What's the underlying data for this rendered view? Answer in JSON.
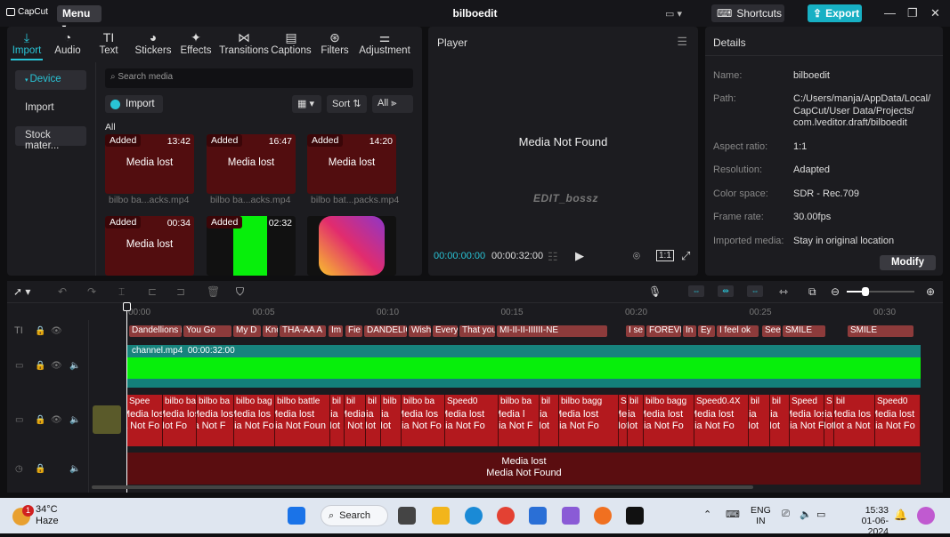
{
  "app": {
    "logo_text": "CapCut",
    "menu_label": "Menu",
    "project_title": "bilboedit",
    "shortcuts_label": "Shortcuts",
    "export_label": "Export"
  },
  "toolbar": {
    "tabs": [
      {
        "label": "Import",
        "icon": "import-icon"
      },
      {
        "label": "Audio",
        "icon": "audio-icon"
      },
      {
        "label": "Text",
        "icon": "text-icon"
      },
      {
        "label": "Stickers",
        "icon": "stickers-icon"
      },
      {
        "label": "Effects",
        "icon": "effects-icon"
      },
      {
        "label": "Transitions",
        "icon": "transitions-icon"
      },
      {
        "label": "Captions",
        "icon": "captions-icon"
      },
      {
        "label": "Filters",
        "icon": "filters-icon"
      },
      {
        "label": "Adjustment",
        "icon": "adjustment-icon"
      }
    ]
  },
  "side_nav": {
    "items": [
      "Device",
      "Import",
      "Stock mater..."
    ]
  },
  "media": {
    "search_placeholder": "Search media",
    "import_label": "Import",
    "sort_label": "Sort",
    "filter_label": "All",
    "section_label": "All",
    "items": [
      {
        "badge": "Added",
        "duration": "13:42",
        "status": "Media lost",
        "name": "bilbo ba...acks.mp4"
      },
      {
        "badge": "Added",
        "duration": "16:47",
        "status": "Media lost",
        "name": "bilbo ba...acks.mp4"
      },
      {
        "badge": "Added",
        "duration": "14:20",
        "status": "Media lost",
        "name": "bilbo bat...packs.mp4"
      },
      {
        "badge": "Added",
        "duration": "00:34",
        "status": "Media lost",
        "name": ""
      },
      {
        "badge": "Added",
        "duration": "02:32",
        "status": "",
        "name": ""
      },
      {
        "badge": "",
        "duration": "",
        "status": "",
        "name": ""
      }
    ]
  },
  "player": {
    "title": "Player",
    "message": "Media Not Found",
    "watermark": "EDIT_bossz",
    "current_time": "00:00:00:00",
    "total_time": "00:00:32:00"
  },
  "details": {
    "title": "Details",
    "fields": [
      {
        "label": "Name:",
        "value": "bilboedit"
      },
      {
        "label": "Path:",
        "value": "C:/Users/manja/AppData/Local/ CapCut/User Data/Projects/ com.lveditor.draft/bilboedit"
      },
      {
        "label": "Aspect ratio:",
        "value": "1:1"
      },
      {
        "label": "Resolution:",
        "value": "Adapted"
      },
      {
        "label": "Color space:",
        "value": "SDR - Rec.709"
      },
      {
        "label": "Frame rate:",
        "value": "30.00fps"
      },
      {
        "label": "Imported media:",
        "value": "Stay in original location"
      }
    ],
    "modify_label": "Modify"
  },
  "timeline": {
    "ruler": [
      "00:00",
      "00:05",
      "00:10",
      "00:15",
      "00:20",
      "00:25",
      "00:30"
    ],
    "text_clips": [
      "Dandellions i",
      "You Go",
      "My D",
      "Kno",
      "THA-AA A",
      "Im",
      "Fie",
      "DANDELIC",
      "Wish",
      "Every",
      "That you",
      "MI-II-II-IIIIII-NE",
      "I se",
      "FOREVE",
      "In",
      "Ey",
      "I feel ok",
      "See",
      "SMILE",
      "SMILE"
    ],
    "main_clip_name": "channel.mp4",
    "main_clip_duration": "00:00:32:00",
    "lost_clips": [
      {
        "title": "Spee",
        "l1": "Media los",
        "l2": "a Not Fo"
      },
      {
        "title": "bilbo ba",
        "l1": "Media los",
        "l2": "Not Fo"
      },
      {
        "title": "bilbo ba",
        "l1": "Media los",
        "l2": "ia Not F"
      },
      {
        "title": "bilbo bag",
        "l1": "Media los",
        "l2": "dia Not Fo"
      },
      {
        "title": "bilbo battle",
        "l1": "Media lost",
        "l2": "dia Not Foun"
      },
      {
        "title": "bil",
        "l1": "dia",
        "l2": "Not"
      },
      {
        "title": "bil",
        "l1": "Media",
        "l2": "a Not"
      },
      {
        "title": "bil",
        "l1": "dia",
        "l2": "Not"
      },
      {
        "title": "bilb",
        "l1": "dia",
        "l2": "Not"
      },
      {
        "title": "bilbo ba",
        "l1": "Media los",
        "l2": "dia Not Fo"
      },
      {
        "title": "Speed0",
        "l1": "Media lost",
        "l2": "dia Not Fo"
      },
      {
        "title": "bilbo ba",
        "l1": "Media l",
        "l2": "dia Not F"
      },
      {
        "title": "bil",
        "l1": "dia",
        "l2": "Not"
      },
      {
        "title": "bilbo bagg",
        "l1": "Media lost",
        "l2": "dia Not Fo"
      },
      {
        "title": "S",
        "l1": "Media",
        "l2": "Not"
      },
      {
        "title": "bil",
        "l1": "dia",
        "l2": "Not"
      },
      {
        "title": "bilbo bagg",
        "l1": "Media lost",
        "l2": "dia Not Fo"
      },
      {
        "title": "Speed0.4X",
        "l1": "Media lost",
        "l2": "dia Not Fo"
      },
      {
        "title": "bil",
        "l1": "dia",
        "l2": "Not"
      },
      {
        "title": "bil",
        "l1": "dia",
        "l2": "Not"
      },
      {
        "title": "Speed",
        "l1": "Media los",
        "l2": "dia Not Fo"
      },
      {
        "title": "S",
        "l1": "dia",
        "l2": "Not"
      },
      {
        "title": "bil",
        "l1": "Media los",
        "l2": "Not a Not"
      },
      {
        "title": "Speed0",
        "l1": "Media lost",
        "l2": "dia Not Fo"
      }
    ],
    "audio_clip_l1": "Media lost",
    "audio_clip_l2": "Media Not Found"
  },
  "taskbar": {
    "temperature": "34°C",
    "weather": "Haze",
    "notification_count": "1",
    "search_label": "Search",
    "lang_top": "ENG",
    "lang_bottom": "IN",
    "time": "15:33",
    "date": "01-06-2024"
  },
  "colors": {
    "accent": "#29c4d6",
    "lost_clip": "#b3191e",
    "main_clip": "#07ef0b"
  }
}
